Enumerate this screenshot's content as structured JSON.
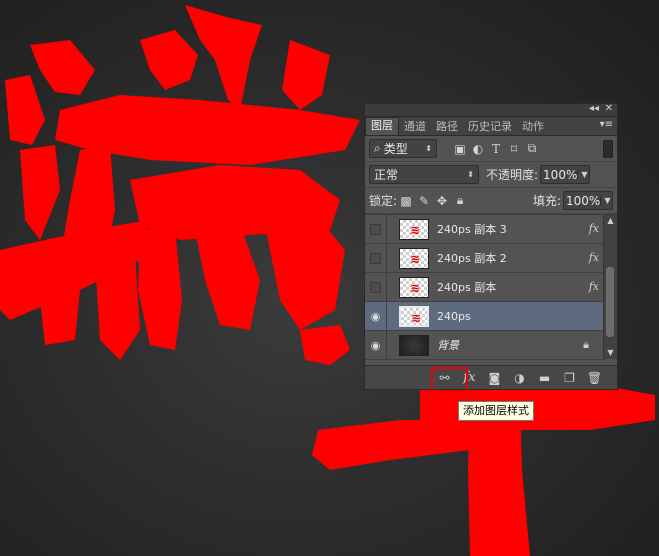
{
  "panel": {
    "header_controls": {
      "collapse": "◂◂",
      "close": "✕"
    },
    "tabs": [
      {
        "label": "图层",
        "active": true
      },
      {
        "label": "通道",
        "active": false
      },
      {
        "label": "路径",
        "active": false
      },
      {
        "label": "历史记录",
        "active": false
      },
      {
        "label": "动作",
        "active": false
      }
    ],
    "tab_menu": "▾≡",
    "filter": {
      "label": "类型",
      "search_icon": "⌕"
    },
    "blend": {
      "mode": "正常",
      "opacity_label": "不透明度:",
      "opacity_value": "100%"
    },
    "lock": {
      "label": "锁定:",
      "fill_label": "填充:",
      "fill_value": "100%"
    },
    "layers": [
      {
        "name": "240ps  副本 3",
        "visible": false,
        "fx": "fx",
        "selected": false
      },
      {
        "name": "240ps  副本 2",
        "visible": false,
        "fx": "fx",
        "selected": false
      },
      {
        "name": "240ps  副本",
        "visible": false,
        "fx": "fx",
        "selected": false
      },
      {
        "name": "240ps",
        "visible": true,
        "selected": true
      },
      {
        "name": "背景",
        "visible": true,
        "locked": true,
        "selected": false
      }
    ],
    "bottom_fx": "fx"
  },
  "tooltip": "添加图层样式",
  "colors": {
    "accent_red": "#ff0000",
    "panel": "#535353",
    "selected_layer": "#5e6a7e",
    "tooltip_bg": "#ffffe1"
  }
}
